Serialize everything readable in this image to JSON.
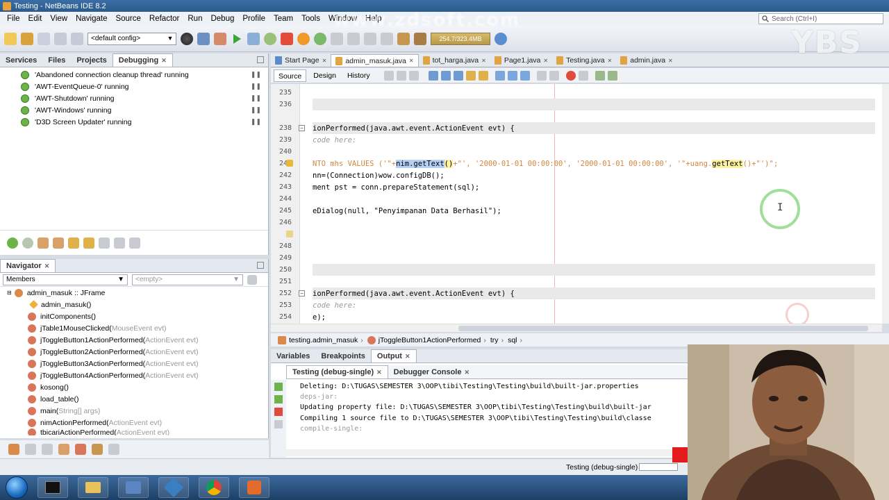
{
  "window": {
    "title": "Testing - NetBeans IDE 8.2"
  },
  "watermark": "www.zdsoft.com",
  "overlay_logo": "YBS",
  "menu": [
    "File",
    "Edit",
    "View",
    "Navigate",
    "Source",
    "Refactor",
    "Run",
    "Debug",
    "Profile",
    "Team",
    "Tools",
    "Window",
    "Help"
  ],
  "search": {
    "placeholder": "Search (Ctrl+I)"
  },
  "toolbar": {
    "config": "<default config>",
    "memory": "254.7/323.4MB"
  },
  "left_panel": {
    "tabs": [
      "Services",
      "Files",
      "Projects",
      "Debugging"
    ],
    "threads": [
      "'Abandoned connection cleanup thread' running",
      "'AWT-EventQueue-0' running",
      "'AWT-Shutdown' running",
      "'AWT-Windows' running",
      "'D3D Screen Updater' running"
    ]
  },
  "navigator": {
    "title": "Navigator",
    "filter_label": "Members",
    "filter_empty": "<empty>",
    "root": "admin_masuk :: JFrame",
    "members": [
      {
        "name": "admin_masuk()",
        "param": ""
      },
      {
        "name": "initComponents()",
        "param": ""
      },
      {
        "name": "jTable1MouseClicked(",
        "param": "MouseEvent evt)"
      },
      {
        "name": "jToggleButton1ActionPerformed(",
        "param": "ActionEvent evt)"
      },
      {
        "name": "jToggleButton2ActionPerformed(",
        "param": "ActionEvent evt)"
      },
      {
        "name": "jToggleButton3ActionPerformed(",
        "param": "ActionEvent evt)"
      },
      {
        "name": "jToggleButton4ActionPerformed(",
        "param": "ActionEvent evt)"
      },
      {
        "name": "kosong()",
        "param": ""
      },
      {
        "name": "load_table()",
        "param": ""
      },
      {
        "name": "main(",
        "param": "String[] args)"
      },
      {
        "name": "nimActionPerformed(",
        "param": "ActionEvent evt)"
      },
      {
        "name": "tbicariActionPerformed(",
        "param": "ActionEvent evt)"
      }
    ]
  },
  "editor": {
    "tabs": [
      "Start Page",
      "admin_masuk.java",
      "tot_harga.java",
      "Page1.java",
      "Testing.java",
      "admin.java"
    ],
    "subtabs": [
      "Source",
      "Design",
      "History"
    ],
    "lines": [
      {
        "n": "235",
        "text": ""
      },
      {
        "n": "236",
        "text": ""
      },
      {
        "n": "238",
        "text": "ionPerformed(java.awt.event.ActionEvent evt) {"
      },
      {
        "n": "239",
        "text": "code here:"
      },
      {
        "n": "240",
        "text": ""
      },
      {
        "n": "241",
        "text": ""
      },
      {
        "n": "242",
        "text": "nn=(Connection)wow.configDB();"
      },
      {
        "n": "243",
        "text": "ment pst = conn.prepareStatement(sql);"
      },
      {
        "n": "244",
        "text": ""
      },
      {
        "n": "245",
        "text": "eDialog(null, \"Penyimpanan Data Berhasil\");"
      },
      {
        "n": "246",
        "text": ""
      },
      {
        "n": "248",
        "text": ""
      },
      {
        "n": "249",
        "text": ""
      },
      {
        "n": "250",
        "text": ""
      },
      {
        "n": "251",
        "text": ""
      },
      {
        "n": "252",
        "text": "ionPerformed(java.awt.event.ActionEvent evt) {"
      },
      {
        "n": "253",
        "text": "code here:"
      },
      {
        "n": "254",
        "text": "e);"
      }
    ],
    "line241_parts": [
      "NTO mhs VALUES ('\"+",
      "nim.getText",
      "()",
      "+\"', '2000-01-01 00:00:00', '2000-01-01 00:00:00', '\"+uang.",
      "getText",
      "()+\"')\";"
    ]
  },
  "breadcrumbs": [
    "testing.admin_masuk",
    "jToggleButton1ActionPerformed",
    "try",
    "sql"
  ],
  "output": {
    "tabs": [
      "Variables",
      "Breakpoints",
      "Output"
    ],
    "inner_tabs": [
      "Testing (debug-single)",
      "Debugger Console"
    ],
    "lines": [
      "Deleting: D:\\TUGAS\\SEMESTER 3\\OOP\\tibi\\Testing\\Testing\\build\\built-jar.properties",
      "deps-jar:",
      "Updating property file: D:\\TUGAS\\SEMESTER 3\\OOP\\tibi\\Testing\\Testing\\build\\built-jar",
      "Compiling 1 source file to D:\\TUGAS\\SEMESTER 3\\OOP\\tibi\\Testing\\Testing\\build\\classe",
      "compile-single:"
    ]
  },
  "status": {
    "text": "Testing (debug-single)"
  },
  "colors": {
    "accent": "#3b6ea5",
    "keyword": "#c47f3c",
    "string": "#d2863f",
    "comment": "#999999"
  },
  "icons": [
    "netbeans-icon",
    "search-icon",
    "new-file-icon",
    "open-project-icon",
    "run-icon",
    "debug-icon",
    "stop-icon",
    "thread-icon",
    "java-file-icon",
    "method-icon",
    "windows-start-icon",
    "chrome-icon"
  ]
}
